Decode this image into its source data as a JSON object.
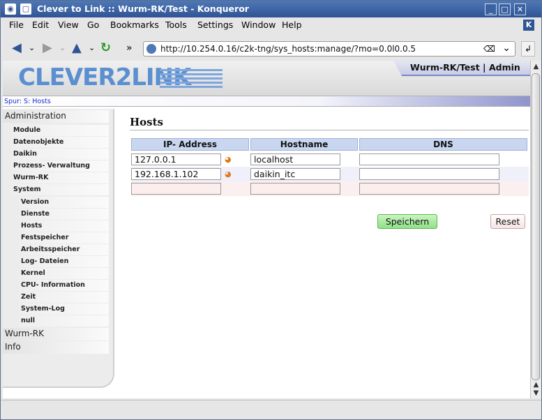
{
  "window": {
    "title": "Clever to Link :: Wurm-RK/Test - Konqueror"
  },
  "menu": [
    "File",
    "Edit",
    "View",
    "Go",
    "Bookmarks",
    "Tools",
    "Settings",
    "Window",
    "Help"
  ],
  "toolbar": {
    "url": "http://10.254.0.16/c2k-tng/sys_hosts:manage/?mo=0.0l0.0.5",
    "overflow": "»"
  },
  "page": {
    "logo": "CLEVER2LINK",
    "user_tab": "Wurm-RK/Test | Admin",
    "trail": "Spur: S: Hosts",
    "sidebar": {
      "administration": "Administration",
      "items": [
        "Module",
        "Datenobjekte",
        "Daikin",
        "Prozess- Verwaltung",
        "Wurm-RK",
        "System"
      ],
      "system_items": [
        "Version",
        "Dienste",
        "Hosts",
        "Festspeicher",
        "Arbeitsspeicher",
        "Log- Dateien",
        "Kernel",
        "CPU- Information",
        "Zeit",
        "System-Log",
        "null"
      ],
      "wurm_rk": "Wurm-RK",
      "info": "Info"
    },
    "content": {
      "title": "Hosts",
      "columns": [
        "IP- Address",
        "Hostname",
        "DNS"
      ],
      "rows": [
        {
          "ip": "127.0.0.1",
          "hostname": "localhost",
          "dns": ""
        },
        {
          "ip": "192.168.1.102",
          "hostname": "daikin_itc",
          "dns": ""
        },
        {
          "ip": "",
          "hostname": "",
          "dns": ""
        }
      ],
      "save_label": "Speichern",
      "reset_label": "Reset"
    }
  }
}
